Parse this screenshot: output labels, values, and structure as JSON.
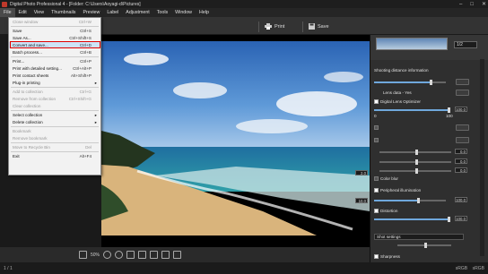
{
  "window": {
    "title": "Digital Photo Professional 4 - [Folder: C:\\Users\\Aoyagi-d\\Pictures]"
  },
  "menubar": [
    "File",
    "Edit",
    "View",
    "Thumbnails",
    "Preview",
    "Label",
    "Adjustment",
    "Tools",
    "Window",
    "Help"
  ],
  "toolbar": {
    "print_label": "Print",
    "save_label": "Save"
  },
  "file_menu": [
    {
      "label": "Close window",
      "shortcut": "Ctrl+W",
      "enabled": false
    },
    {
      "label": "Save",
      "shortcut": "Ctrl+S",
      "enabled": true
    },
    {
      "label": "Save As...",
      "shortcut": "Ctrl+Shift+S",
      "enabled": true
    },
    {
      "label": "Convert and save...",
      "shortcut": "Ctrl+D",
      "enabled": true
    },
    {
      "label": "Batch process...",
      "shortcut": "Ctrl+B",
      "enabled": true
    },
    {
      "label": "Print...",
      "shortcut": "Ctrl+P",
      "enabled": true
    },
    {
      "label": "Print with detailed setting...",
      "shortcut": "Ctrl+Alt+P",
      "enabled": true
    },
    {
      "label": "Print contact sheets",
      "shortcut": "Alt+Shift+P",
      "enabled": true
    },
    {
      "label": "Plug-in printing",
      "shortcut": "",
      "enabled": true,
      "submenu": true
    },
    {
      "label": "Add to collection",
      "shortcut": "Ctrl+G",
      "enabled": false
    },
    {
      "label": "Remove from collection",
      "shortcut": "Ctrl+Shift+G",
      "enabled": false
    },
    {
      "label": "Clear collection",
      "shortcut": "",
      "enabled": false
    },
    {
      "label": "Select collection",
      "shortcut": "",
      "enabled": true,
      "submenu": true
    },
    {
      "label": "Delete collection",
      "shortcut": "",
      "enabled": true,
      "submenu": true
    },
    {
      "label": "Bookmark",
      "shortcut": "",
      "enabled": false
    },
    {
      "label": "Remove bookmark",
      "shortcut": "",
      "enabled": false
    },
    {
      "label": "Move to Recycle Bin",
      "shortcut": "Del",
      "enabled": false
    },
    {
      "label": "Exit",
      "shortcut": "Alt+F4",
      "enabled": true
    }
  ],
  "viewer": {
    "zoom": "50%"
  },
  "rpanel": {
    "zoom_select": "1/2",
    "shooting_distance": "Shooting distance information",
    "lens_data": "Lens data - Yes",
    "digital_lens_optimizer": "Digital Lens Optimizer",
    "dlo_value": "100.0",
    "dlo_min": "0",
    "dlo_max": "100",
    "color_blur": "Color blur",
    "peripheral": "Peripheral illumination",
    "peripheral_value": "100.0",
    "distortion": "Distortion",
    "distortion_value": "100.0",
    "shot_settings": "Shot settings",
    "sharpness": "Sharpness",
    "zero_values": [
      "0.0",
      "0.0",
      "0.0"
    ],
    "side_vals": [
      "2.0",
      "10.0"
    ]
  },
  "status": {
    "left": "1 / 1",
    "right1": "sRGB",
    "right2": "sRGB"
  }
}
